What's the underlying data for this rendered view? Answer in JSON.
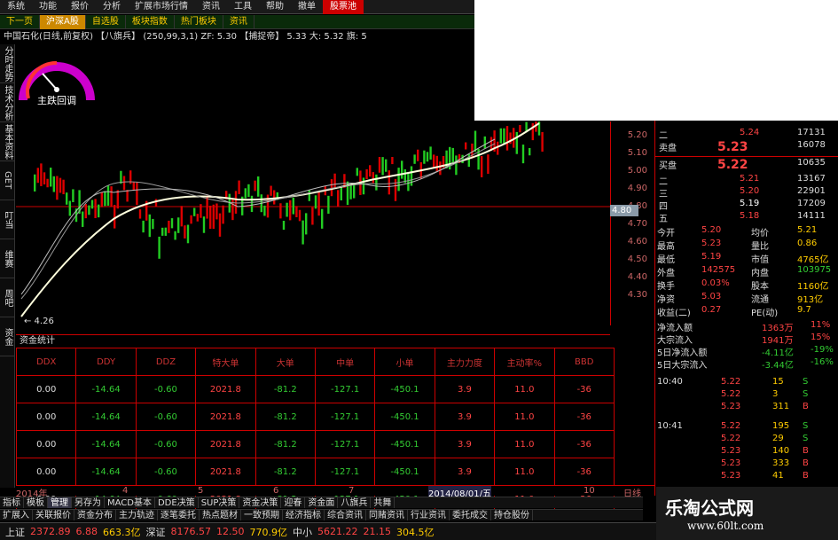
{
  "menu": [
    "系统",
    "功能",
    "报价",
    "分析",
    "扩展市场行情",
    "资讯",
    "工具",
    "帮助"
  ],
  "menu_highlight": "股票池",
  "menu_extra": "撤单",
  "toolbar": [
    "下一页",
    "自选股",
    "板块指数",
    "热门板块",
    "资讯"
  ],
  "toolbar_selected": "沪深A股",
  "title_line": "中国石化(日线,前复权) 【八旗兵】 (250,99,3,1)  ZF: 5.30  【捕捉帝】 5.33  大: 5.32  旗: 5",
  "leftnav": [
    "分时走势",
    "技术分析",
    "基本资料",
    "GET",
    "叮当",
    "维赛",
    "周吧",
    "资金"
  ],
  "gauge_label": "主跌回调",
  "price_axis": [
    "5.20",
    "5.10",
    "5.00",
    "4.90",
    "4.80",
    "4.70",
    "4.60",
    "4.50",
    "4.40",
    "4.30"
  ],
  "current_price_tag": "4.80",
  "min_label": "← 4.26",
  "section_title": "资金统计",
  "table": {
    "headers": [
      "DDX",
      "DDY",
      "DDZ",
      "特大单",
      "大单",
      "中单",
      "小单",
      "主力力度",
      "主动率%",
      "BBD"
    ],
    "rows": [
      [
        "0.00",
        "-14.64",
        "-0.60",
        "2021.8",
        "-81.2",
        "-127.1",
        "-450.1",
        "3.9",
        "11.0",
        "-36"
      ],
      [
        "0.00",
        "-14.64",
        "-0.60",
        "2021.8",
        "-81.2",
        "-127.1",
        "-450.1",
        "3.9",
        "11.0",
        "-36"
      ],
      [
        "0.00",
        "-14.64",
        "-0.60",
        "2021.8",
        "-81.2",
        "-127.1",
        "-450.1",
        "3.9",
        "11.0",
        "-36"
      ],
      [
        "0.00",
        "-14.64",
        "-0.60",
        "2021.8",
        "-81.2",
        "-127.1",
        "-450.1",
        "3.9",
        "11.0",
        "-36"
      ],
      [
        "0.00",
        "-14.64",
        "-0.60",
        "2021.8",
        "-81.2",
        "-127.1",
        "-450.1",
        "3.9",
        "11.0",
        "-36"
      ]
    ]
  },
  "time_axis": [
    "2014年",
    "4",
    "5",
    "6",
    "7",
    "2014/08/01/五",
    "10",
    "日线"
  ],
  "tabs_row1": [
    "指标",
    "模板",
    "管理",
    "另存为",
    "MACD基本",
    "DDE决策",
    "SUP决策",
    "资金决策",
    "迎春",
    "资金面",
    "八旗兵",
    "共舞"
  ],
  "tabs_row2": [
    "扩展入",
    "关联报价",
    "资金分布",
    "主力轨迹",
    "逐笔委托",
    "热点题材",
    "一致预期",
    "经济指标",
    "综合资讯",
    "同赌资讯",
    "行业资讯",
    "委托成交",
    "持仓股份"
  ],
  "status": {
    "sh_label": "上证",
    "sh_value": "2372.89",
    "sh_change": "6.88",
    "sh_amount": "663.3亿",
    "sz_label": "深证",
    "sz_value": "8176.57",
    "sz_change": "12.50",
    "sz_amount": "770.9亿",
    "zx_label": "中小",
    "zx_value": "5621.22",
    "zx_change": "21.15",
    "zx_amount": "304.5亿"
  },
  "order_book": {
    "sell": [
      {
        "label": "二",
        "price": "5.24",
        "vol": "17131"
      },
      {
        "label": "卖盘",
        "price": "5.23",
        "vol": "16078"
      }
    ],
    "buy": [
      {
        "label": "买盘",
        "price": "5.22",
        "vol": "10635"
      },
      {
        "label": "二",
        "price": "5.21",
        "vol": "13167"
      },
      {
        "label": "三",
        "price": "5.20",
        "vol": "22901"
      },
      {
        "label": "四",
        "price": "5.19",
        "vol": "17209"
      },
      {
        "label": "五",
        "price": "5.18",
        "vol": "14111"
      }
    ]
  },
  "stats": [
    [
      "今开",
      "5.20",
      "均价",
      "5.21"
    ],
    [
      "最高",
      "5.23",
      "量比",
      "0.86"
    ],
    [
      "最低",
      "5.19",
      "市值",
      "4765亿"
    ],
    [
      "外盘",
      "142575",
      "内盘",
      "103975"
    ],
    [
      "换手",
      "0.03%",
      "股本",
      "1160亿"
    ],
    [
      "净资",
      "5.03",
      "流通",
      "913亿"
    ],
    [
      "收益(二)",
      "0.27",
      "PE(动)",
      "9.7"
    ]
  ],
  "flows": [
    [
      "净流入额",
      "1363万",
      "11%"
    ],
    [
      "大宗流入",
      "1941万",
      "15%"
    ],
    [
      "5日净流入额",
      "-4.11亿",
      "-19%"
    ],
    [
      "5日大宗流入",
      "-3.44亿",
      "-16%"
    ]
  ],
  "ticks": [
    [
      "10:40",
      "5.22",
      "15",
      "S"
    ],
    [
      "",
      "5.22",
      "3",
      "S"
    ],
    [
      "",
      "5.23",
      "311",
      "B"
    ],
    [
      "10:41",
      "5.22",
      "195",
      "S"
    ],
    [
      "",
      "5.22",
      "29",
      "S"
    ],
    [
      "",
      "5.23",
      "140",
      "B"
    ],
    [
      "",
      "5.23",
      "333",
      "B"
    ],
    [
      "",
      "5.23",
      "41",
      "B"
    ]
  ],
  "ad_title": "乐淘公式网",
  "ad_url": "www.60lt.com"
}
